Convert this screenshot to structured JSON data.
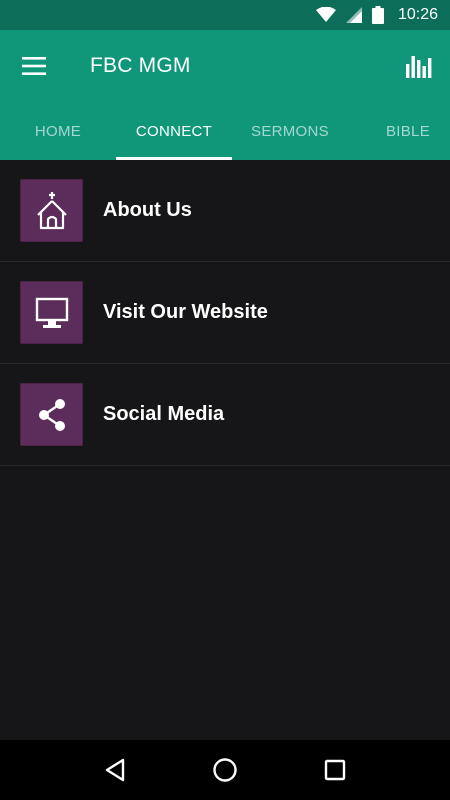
{
  "status_bar": {
    "time": "10:26",
    "icons": [
      "wifi-icon",
      "cell-signal-icon",
      "battery-icon"
    ]
  },
  "app_bar": {
    "title": "FBC MGM",
    "left_icon": "hamburger-menu-icon",
    "right_icon": "bar-chart-icon",
    "color": "#10977a"
  },
  "tabs": [
    {
      "label": "HOME",
      "active": false
    },
    {
      "label": "CONNECT",
      "active": true
    },
    {
      "label": "SERMONS",
      "active": false
    },
    {
      "label": "BIBLE",
      "active": false
    }
  ],
  "list": {
    "items": [
      {
        "label": "About Us",
        "icon": "church-icon"
      },
      {
        "label": "Visit Our Website",
        "icon": "monitor-icon"
      },
      {
        "label": "Social Media",
        "icon": "share-icon"
      }
    ],
    "icon_bg": "#5c2c5a"
  },
  "nav_bar": {
    "icons": [
      "back-icon",
      "home-icon",
      "recents-icon"
    ]
  }
}
